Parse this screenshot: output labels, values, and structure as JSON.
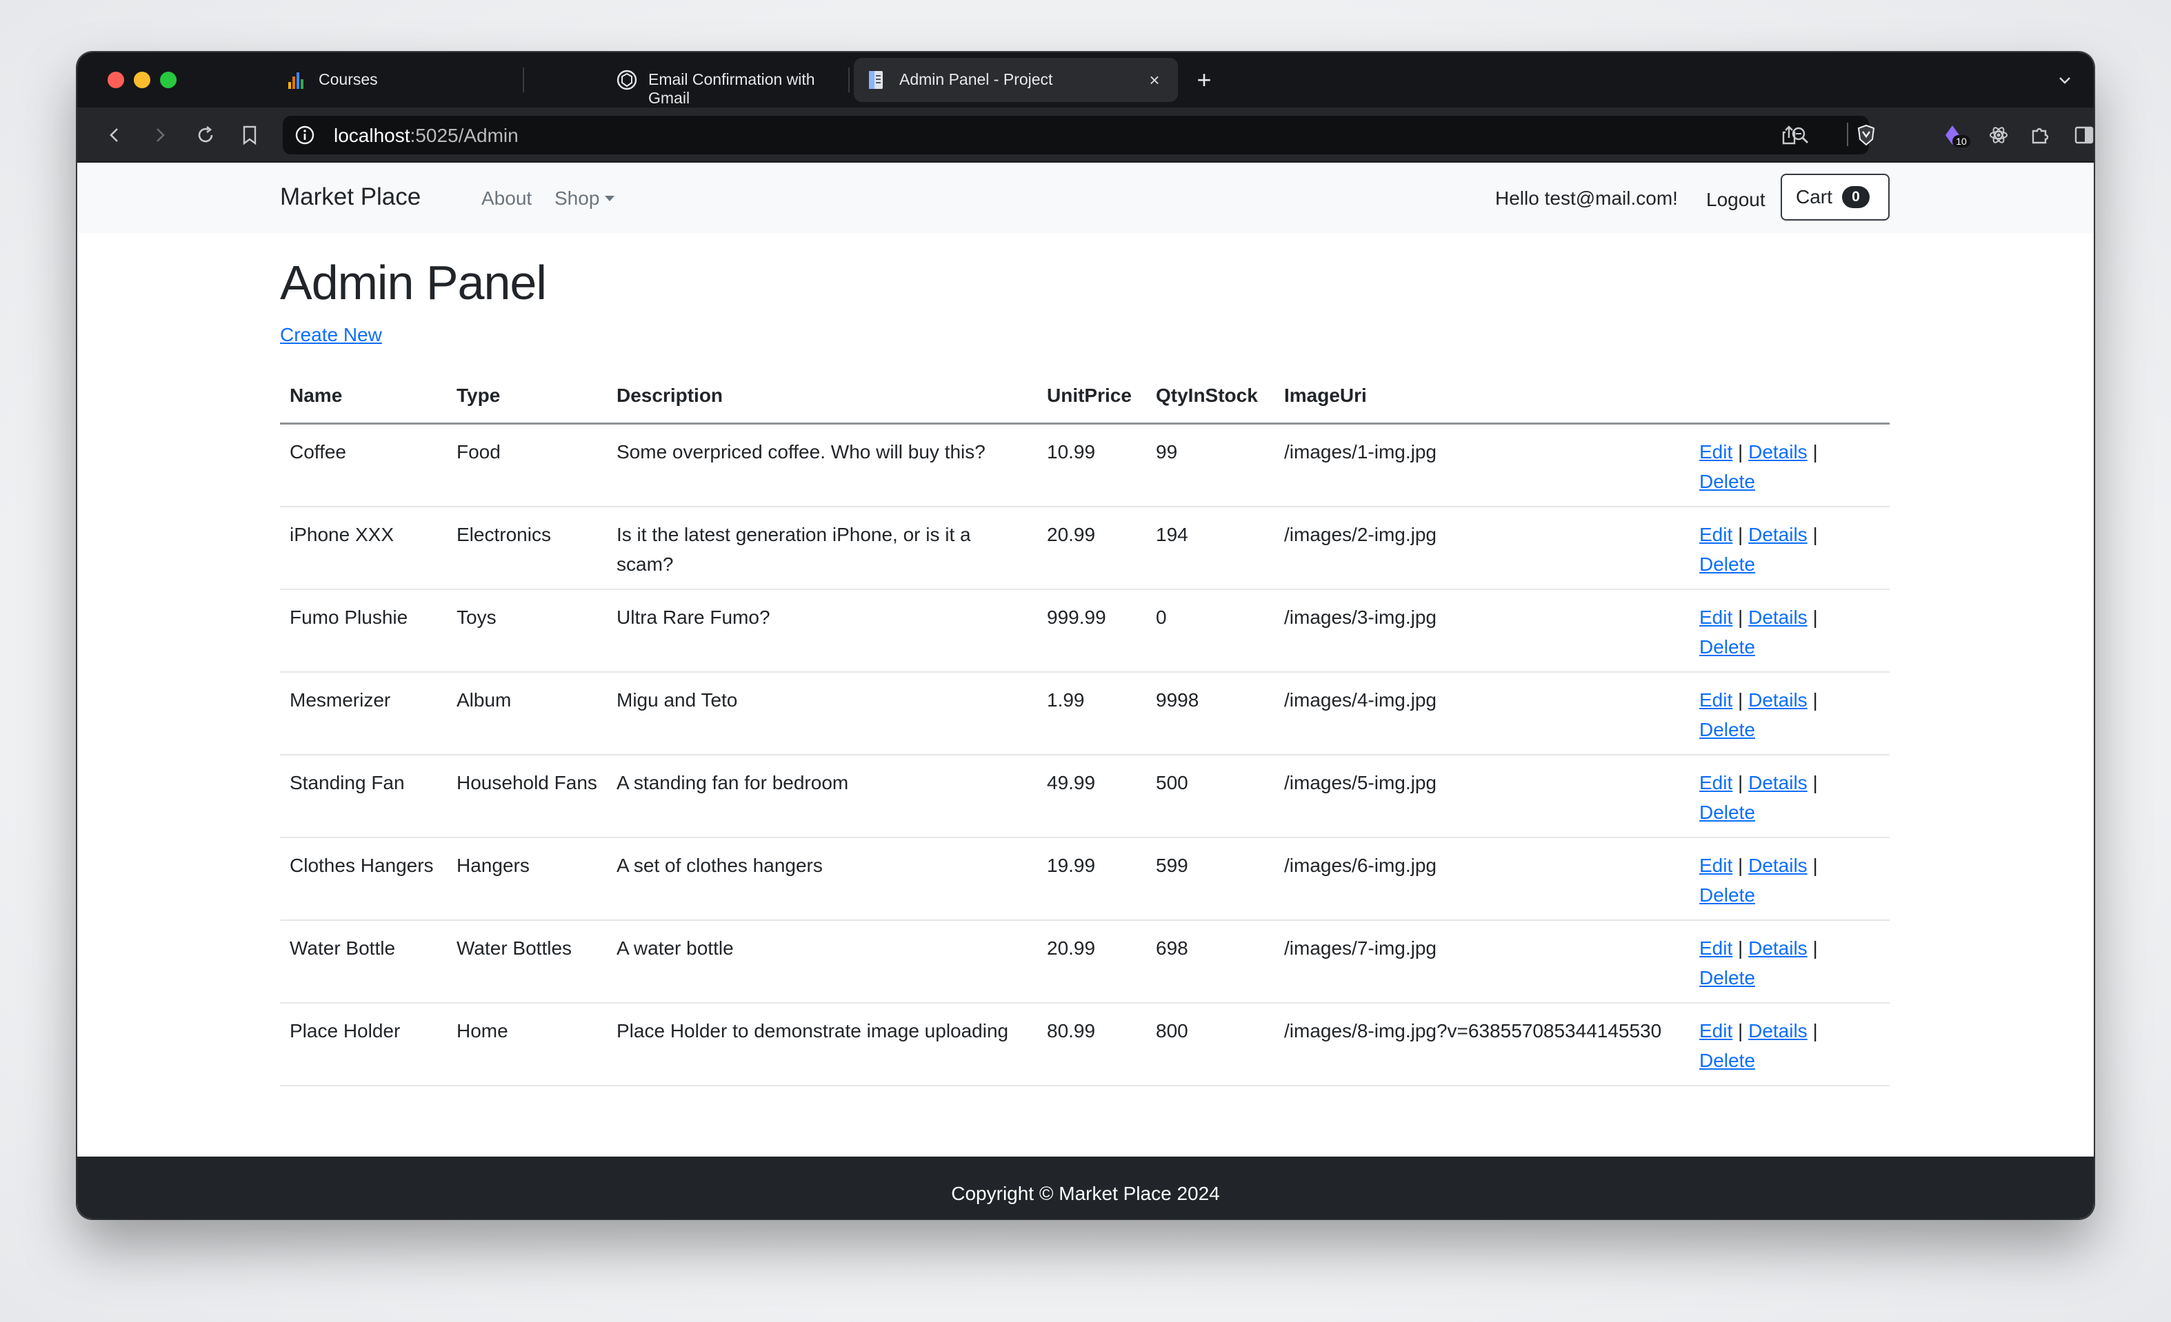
{
  "browser": {
    "tabs": [
      {
        "label": "Courses",
        "active": false
      },
      {
        "label": "Email Confirmation with Gmail",
        "active": false
      },
      {
        "label": "Admin Panel - Project",
        "active": true
      }
    ],
    "url": {
      "host": "localhost",
      "path": ":5025/Admin"
    },
    "extension_badge": "10"
  },
  "navbar": {
    "brand": "Market Place",
    "links": {
      "about": "About",
      "shop": "Shop"
    },
    "greeting": "Hello test@mail.com!",
    "logout": "Logout",
    "cart_label": "Cart",
    "cart_count": "0"
  },
  "main": {
    "title": "Admin Panel",
    "create_new": "Create New",
    "columns": [
      "Name",
      "Type",
      "Description",
      "UnitPrice",
      "QtyInStock",
      "ImageUri"
    ],
    "actions": {
      "edit": "Edit",
      "details": "Details",
      "delete": "Delete",
      "sep": "|"
    },
    "rows": [
      {
        "name": "Coffee",
        "type": "Food",
        "description": "Some overpriced coffee. Who will buy this?",
        "price": "10.99",
        "qty": "99",
        "image": "/images/1-img.jpg"
      },
      {
        "name": "iPhone XXX",
        "type": "Electronics",
        "description": "Is it the latest generation iPhone, or is it a scam?",
        "price": "20.99",
        "qty": "194",
        "image": "/images/2-img.jpg"
      },
      {
        "name": "Fumo Plushie",
        "type": "Toys",
        "description": "Ultra Rare Fumo?",
        "price": "999.99",
        "qty": "0",
        "image": "/images/3-img.jpg"
      },
      {
        "name": "Mesmerizer",
        "type": "Album",
        "description": "Migu and Teto",
        "price": "1.99",
        "qty": "9998",
        "image": "/images/4-img.jpg"
      },
      {
        "name": "Standing Fan",
        "type": "Household Fans",
        "description": "A standing fan for bedroom",
        "price": "49.99",
        "qty": "500",
        "image": "/images/5-img.jpg"
      },
      {
        "name": "Clothes Hangers",
        "type": "Hangers",
        "description": "A set of clothes hangers",
        "price": "19.99",
        "qty": "599",
        "image": "/images/6-img.jpg"
      },
      {
        "name": "Water Bottle",
        "type": "Water Bottles",
        "description": "A water bottle",
        "price": "20.99",
        "qty": "698",
        "image": "/images/7-img.jpg"
      },
      {
        "name": "Place Holder",
        "type": "Home",
        "description": "Place Holder to demonstrate image uploading",
        "price": "80.99",
        "qty": "800",
        "image": "/images/8-img.jpg?v=638557085344145530"
      }
    ]
  },
  "footer": {
    "text": "Copyright © Market Place 2024"
  },
  "colors": {
    "link": "#0d6efd",
    "footer_bg": "#212529",
    "navbar_bg": "#f8f9fa"
  }
}
